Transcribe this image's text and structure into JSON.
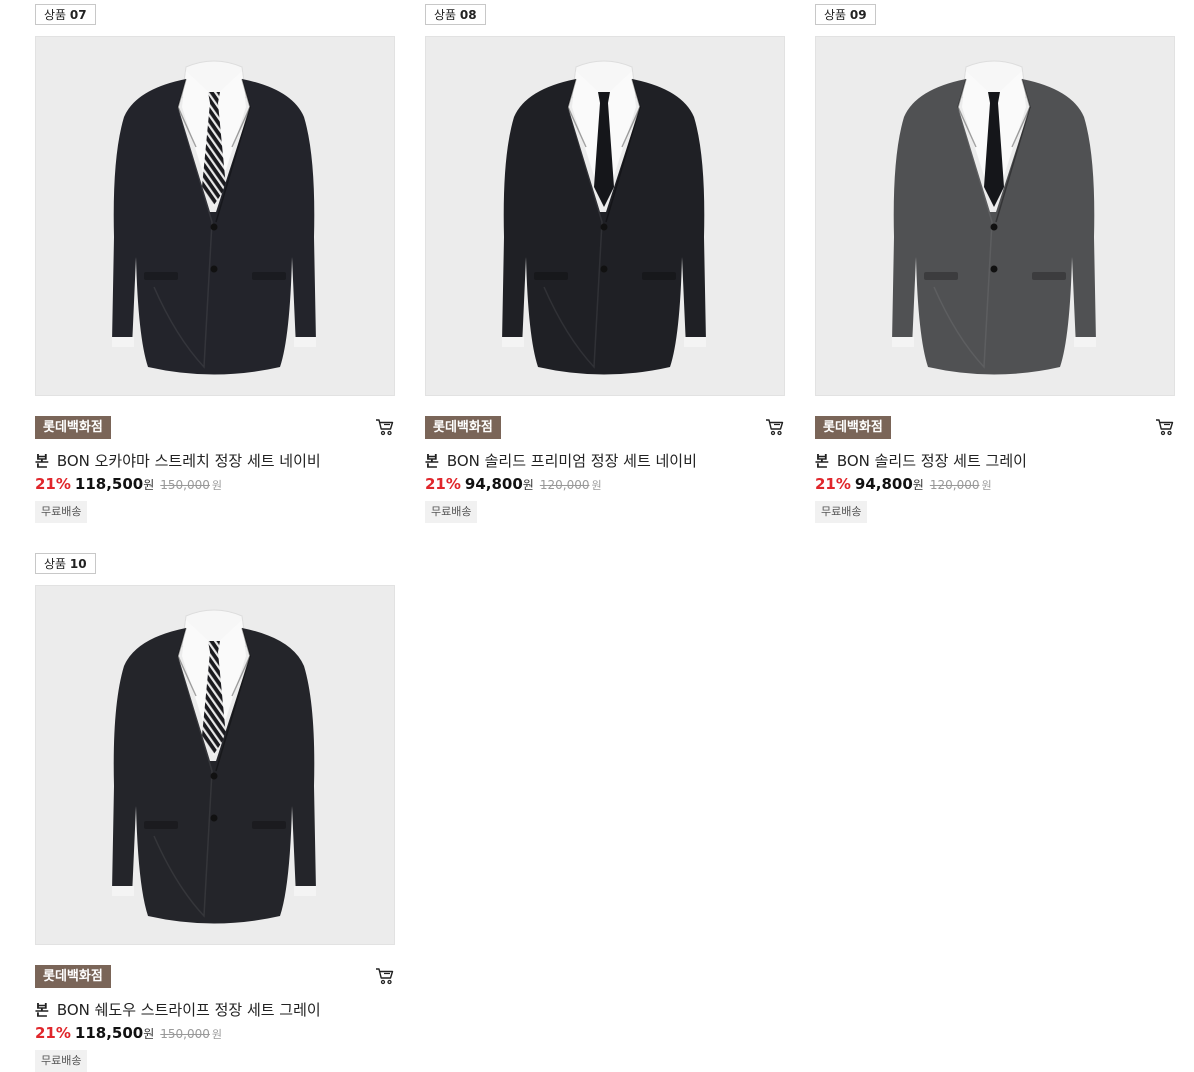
{
  "products": [
    {
      "number_prefix": "상품",
      "number": "07",
      "store": "롯데백화점",
      "brand": "본",
      "name": "BON 오카야마 스트레치 정장 세트 네이비",
      "discount": "21%",
      "price": "118,500",
      "currency": "원",
      "original_price": "150,000",
      "original_currency": "원",
      "shipping": "무료배송",
      "image": "navy-suit-striped-tie",
      "jacket_color": "#23242b",
      "tie_style": "striped"
    },
    {
      "number_prefix": "상품",
      "number": "08",
      "store": "롯데백화점",
      "brand": "본",
      "name": "BON 솔리드 프리미엄 정장 세트 네이비",
      "discount": "21%",
      "price": "94,800",
      "currency": "원",
      "original_price": "120,000",
      "original_currency": "원",
      "shipping": "무료배송",
      "image": "navy-suit-solid-tie",
      "jacket_color": "#1f2025",
      "tie_style": "solid"
    },
    {
      "number_prefix": "상품",
      "number": "09",
      "store": "롯데백화점",
      "brand": "본",
      "name": "BON 솔리드 정장 세트 그레이",
      "discount": "21%",
      "price": "94,800",
      "currency": "원",
      "original_price": "120,000",
      "original_currency": "원",
      "shipping": "무료배송",
      "image": "gray-suit-solid-tie",
      "jacket_color": "#505153",
      "tie_style": "solid"
    },
    {
      "number_prefix": "상품",
      "number": "10",
      "store": "롯데백화점",
      "brand": "본",
      "name": "BON 쉐도우 스트라이프 정장 세트 그레이",
      "discount": "21%",
      "price": "118,500",
      "currency": "원",
      "original_price": "150,000",
      "original_currency": "원",
      "shipping": "무료배송",
      "image": "charcoal-suit-striped-tie",
      "jacket_color": "#24252a",
      "tie_style": "striped"
    }
  ],
  "colors": {
    "store_badge_bg": "#7a6558",
    "discount": "#e0262b",
    "image_bg": "#ececec"
  },
  "icons": {
    "cart": "cart-icon"
  }
}
